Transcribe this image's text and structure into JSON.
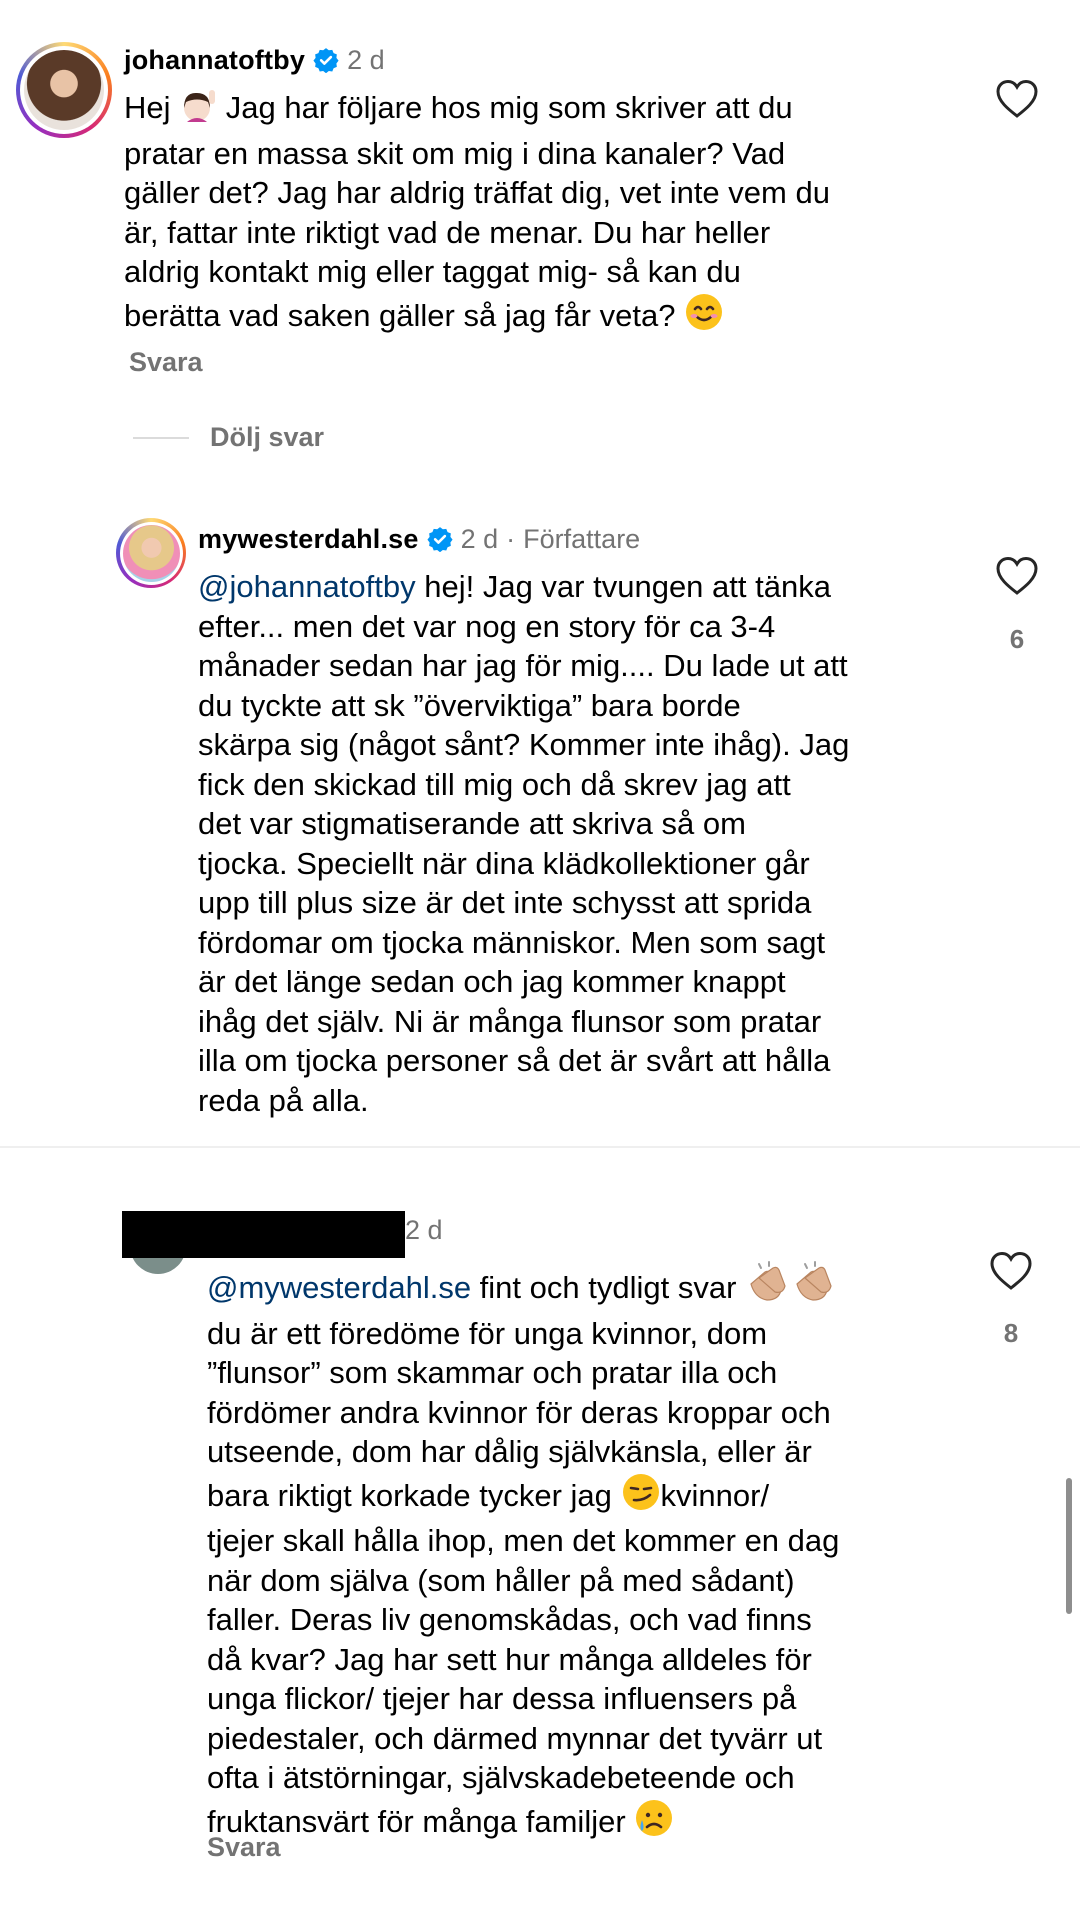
{
  "comment1": {
    "username": "johannatoftby",
    "time": "2 d",
    "text_before": "Hej ",
    "text_after": " Jag har följare hos mig som skriver att du\npratar en massa skit om mig i dina kanaler? Vad\ngäller det? Jag har aldrig träffat dig, vet inte vem du\när, fattar inte riktigt vad de menar. Du har heller\naldrig kontakt mig eller taggat mig- så kan du\nberätta vad saken gäller så jag får veta? ",
    "reply_label": "Svara"
  },
  "hide_replies_label": "Dölj svar",
  "reply1": {
    "username": "mywesterdahl.se",
    "time": "2 d",
    "separator": "·",
    "author_label": "Författare",
    "mention": "@johannatoftby",
    "text": " hej! Jag var tvungen att tänka\nefter... men det var nog en story för ca 3-4\nmånader sedan har jag för mig.... Du lade ut att\ndu tyckte att sk ”överviktiga” bara borde\nskärpa sig (något sånt? Kommer inte ihåg). Jag\nfick den skickad till mig och då skrev jag att\ndet var stigmatiserande att skriva så om\ntjocka. Speciellt när dina klädkollektioner går\nupp till plus size är det inte schysst att sprida\nfördomar om tjocka människor. Men som sagt\när det länge sedan och jag kommer knappt\nihåg det själv. Ni är många flunsor som pratar\nilla om tjocka personer så det är svårt att hålla\nreda på alla.",
    "like_count": "6"
  },
  "reply2": {
    "time": "2 d",
    "mention": "@mywesterdahl.se",
    "text_a": " fint och tydligt svar ",
    "text_b": "\ndu är ett föredöme för unga kvinnor, dom\n”flunsor” som skammar och pratar illa och\nfördömer andra kvinnor för deras kroppar och\nutseende, dom har dålig självkänsla, eller är\nbara riktigt korkade tycker jag ",
    "text_c": "kvinnor/\ntjejer skall hålla ihop, men det kommer en dag\nnär dom själva (som håller på med sådant)\nfaller. Deras liv genomskådas, och vad finns\ndå kvar? Jag har sett hur många alldeles för\nunga flickor/ tjejer har dessa influensers på\npiedestaler, och därmed mynnar det tyvärr ut\nofta i ätstörningar, självskadebeteende och\nfruktansvärt för många familjer ",
    "like_count": "8",
    "reply_label": "Svara"
  },
  "colors": {
    "link": "#00376b",
    "meta": "#737373",
    "verified": "#0095f6",
    "redaction": "#000000"
  }
}
